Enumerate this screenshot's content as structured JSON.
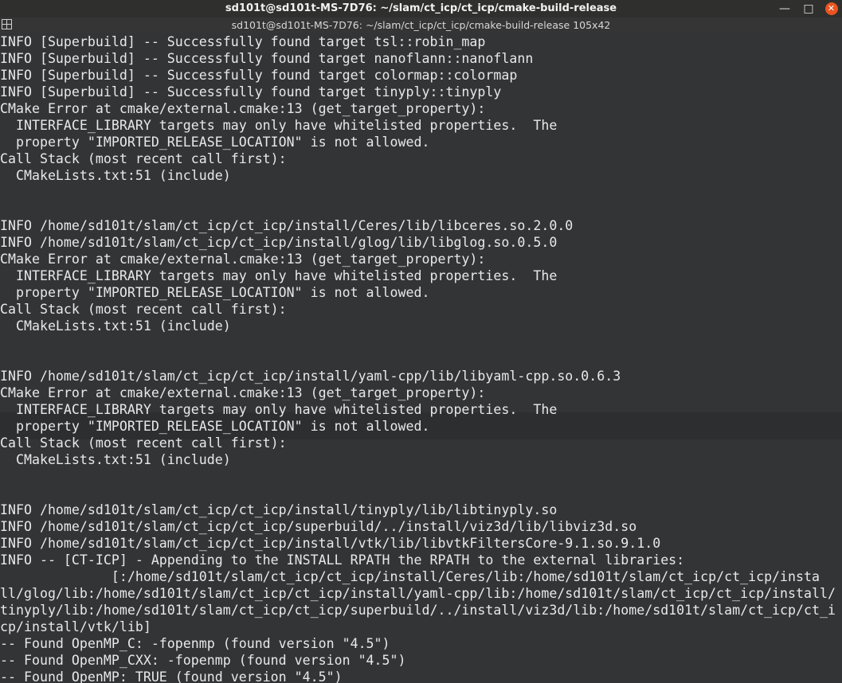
{
  "window": {
    "title": "sd101t@sd101t-MS-7D76: ~/slam/ct_icp/ct_icp/cmake-build-release",
    "minimize_glyph": "—",
    "maximize_glyph": "□",
    "close_glyph": "✕",
    "accent": "#e95420"
  },
  "tab": {
    "title": "sd101t@sd101t-MS-7D76: ~/slam/ct_icp/ct_icp/cmake-build-release 105x42",
    "icon": "terminal-split-icon"
  },
  "terminal": {
    "background": "#333436",
    "foreground": "#e8e8e8",
    "lines": [
      "INFO [Superbuild] -- Successfully found target tsl::robin_map",
      "INFO [Superbuild] -- Successfully found target nanoflann::nanoflann",
      "INFO [Superbuild] -- Successfully found target colormap::colormap",
      "INFO [Superbuild] -- Successfully found target tinyply::tinyply",
      "CMake Error at cmake/external.cmake:13 (get_target_property):",
      "  INTERFACE_LIBRARY targets may only have whitelisted properties.  The",
      "  property \"IMPORTED_RELEASE_LOCATION\" is not allowed.",
      "Call Stack (most recent call first):",
      "  CMakeLists.txt:51 (include)",
      "",
      "",
      "INFO /home/sd101t/slam/ct_icp/ct_icp/install/Ceres/lib/libceres.so.2.0.0",
      "INFO /home/sd101t/slam/ct_icp/ct_icp/install/glog/lib/libglog.so.0.5.0",
      "CMake Error at cmake/external.cmake:13 (get_target_property):",
      "  INTERFACE_LIBRARY targets may only have whitelisted properties.  The",
      "  property \"IMPORTED_RELEASE_LOCATION\" is not allowed.",
      "Call Stack (most recent call first):",
      "  CMakeLists.txt:51 (include)",
      "",
      "",
      "INFO /home/sd101t/slam/ct_icp/ct_icp/install/yaml-cpp/lib/libyaml-cpp.so.0.6.3",
      "CMake Error at cmake/external.cmake:13 (get_target_property):",
      "  INTERFACE_LIBRARY targets may only have whitelisted properties.  The",
      "  property \"IMPORTED_RELEASE_LOCATION\" is not allowed.",
      "Call Stack (most recent call first):",
      "  CMakeLists.txt:51 (include)",
      "",
      "",
      "INFO /home/sd101t/slam/ct_icp/ct_icp/install/tinyply/lib/libtinyply.so",
      "INFO /home/sd101t/slam/ct_icp/ct_icp/superbuild/../install/viz3d/lib/libviz3d.so",
      "INFO /home/sd101t/slam/ct_icp/ct_icp/install/vtk/lib/libvtkFiltersCore-9.1.so.9.1.0",
      "INFO -- [CT-ICP] - Appending to the INSTALL RPATH the RPATH to the external libraries:",
      "              [:/home/sd101t/slam/ct_icp/ct_icp/install/Ceres/lib:/home/sd101t/slam/ct_icp/ct_icp/insta",
      "ll/glog/lib:/home/sd101t/slam/ct_icp/ct_icp/install/yaml-cpp/lib:/home/sd101t/slam/ct_icp/ct_icp/install/",
      "tinyply/lib:/home/sd101t/slam/ct_icp/ct_icp/superbuild/../install/viz3d/lib:/home/sd101t/slam/ct_icp/ct_i",
      "cp/install/vtk/lib]",
      "-- Found OpenMP_C: -fopenmp (found version \"4.5\")",
      "-- Found OpenMP_CXX: -fopenmp (found version \"4.5\")",
      "-- Found OpenMP: TRUE (found version \"4.5\")"
    ]
  }
}
